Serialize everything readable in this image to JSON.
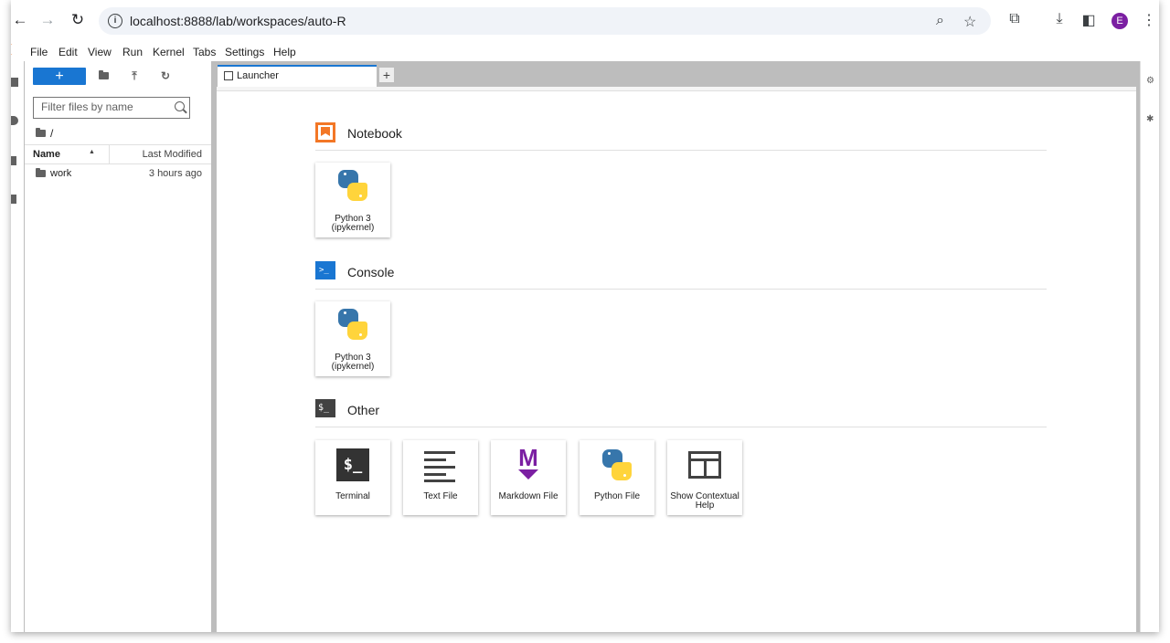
{
  "browser": {
    "url": "localhost:8888/lab/workspaces/auto-R",
    "avatar_letter": "E",
    "back_icon": "arrow-left-icon",
    "forward_icon": "arrow-right-icon",
    "reload_icon": "reload-icon"
  },
  "menubar": {
    "items": [
      "File",
      "Edit",
      "View",
      "Run",
      "Kernel",
      "Tabs",
      "Settings",
      "Help"
    ]
  },
  "filebrowser": {
    "new_label": "+",
    "filter_placeholder": "Filter files by name",
    "breadcrumb": "/",
    "col_name": "Name",
    "col_modified": "Last Modified",
    "rows": [
      {
        "name": "work",
        "modified": "3 hours ago"
      }
    ]
  },
  "tabs": {
    "launcher_label": "Launcher",
    "add_label": "+"
  },
  "launcher": {
    "notebook": {
      "title": "Notebook",
      "cards": [
        {
          "line1": "Python 3",
          "line2": "(ipykernel)"
        }
      ]
    },
    "console": {
      "title": "Console",
      "icon_text": ">_",
      "cards": [
        {
          "line1": "Python 3",
          "line2": "(ipykernel)"
        }
      ]
    },
    "other": {
      "title": "Other",
      "icon_text": "$_",
      "terminal_glyph": "$_",
      "markdown_glyph": "M",
      "cards": [
        {
          "line1": "Terminal",
          "line2": ""
        },
        {
          "line1": "Text File",
          "line2": ""
        },
        {
          "line1": "Markdown File",
          "line2": ""
        },
        {
          "line1": "Python File",
          "line2": ""
        },
        {
          "line1": "Show Contextual",
          "line2": "Help"
        }
      ]
    }
  },
  "colors": {
    "accent": "#1976d2",
    "notebook_orange": "#f37726",
    "markdown_purple": "#7b1fa2",
    "python_blue": "#3776ab",
    "python_yellow": "#ffd43b"
  }
}
